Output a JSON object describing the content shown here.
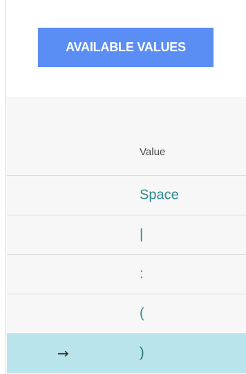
{
  "panel": {
    "title": "AVAILABLE VALUES"
  },
  "table": {
    "column_header": "Value",
    "rows": [
      {
        "value": "Space"
      },
      {
        "value": "|"
      },
      {
        "value": ":"
      },
      {
        "value": "("
      },
      {
        "value": ")"
      }
    ],
    "selected_index": 4,
    "selected_marker_icon": "arrow-right-icon"
  },
  "colors": {
    "title_bg": "#5b8ef5",
    "selected_row_bg": "#b9e4eb",
    "value_text": "#2d8a8f"
  }
}
